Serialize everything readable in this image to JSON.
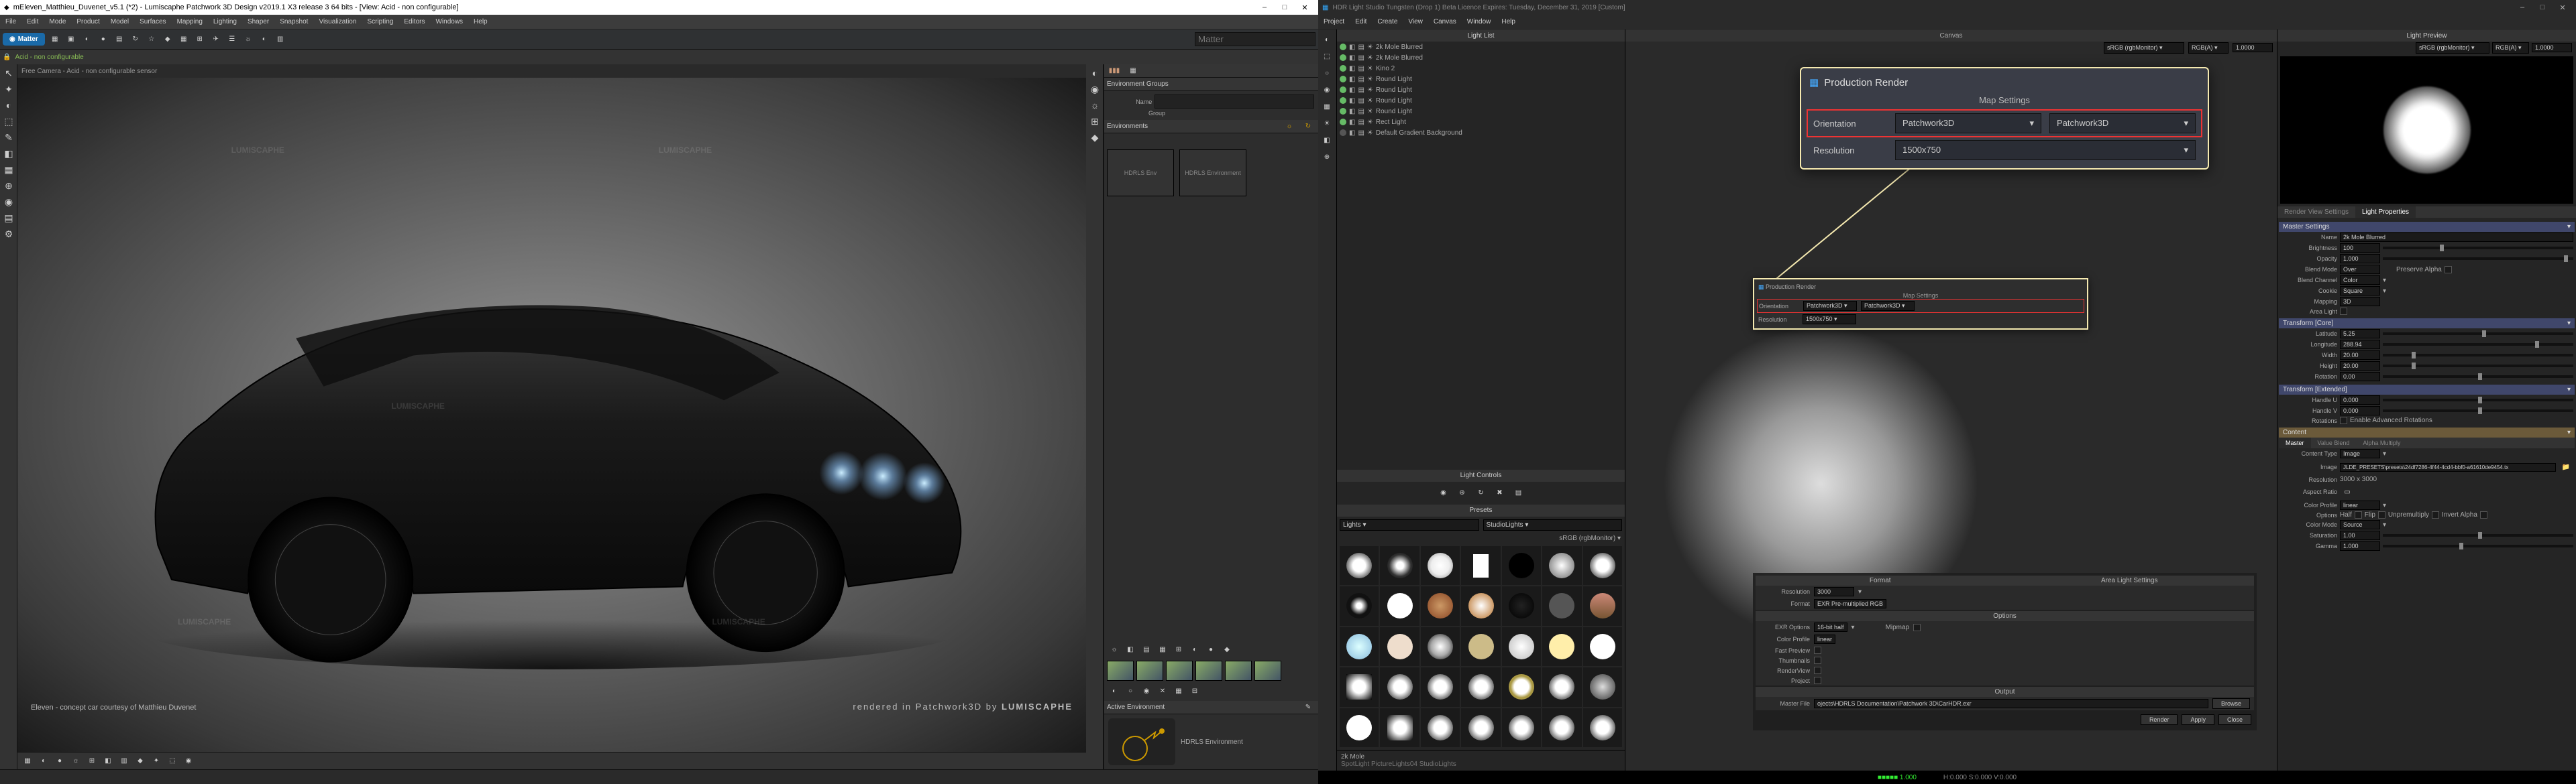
{
  "left_window": {
    "title": "mEleven_Matthieu_Duvenet_v5.1 (*2) - Lumiscaphe Patchwork 3D Design v2019.1 X3 release 3  64 bits - [View: Acid - non configurable]",
    "brand": "Matter",
    "menus": [
      "File",
      "Edit",
      "Mode",
      "Product",
      "Model",
      "Surfaces",
      "Mapping",
      "Lighting",
      "Shaper",
      "Snapshot",
      "Visualization",
      "Scripting",
      "Editors",
      "Windows",
      "Help"
    ],
    "tab_label": "Acid - non configurable",
    "vp_header": "Free Camera - Acid - non configurable sensor",
    "watermark": "LUMISCAPHE",
    "vp_bl": "Eleven - concept car courtesy of Matthieu Duvenet",
    "vp_br_prefix": "rendered in Patchwork3D by",
    "vp_br_brand": "LUMISCAPHE",
    "panels": {
      "env_groups": "Environment Groups",
      "name_lbl": "Name",
      "group_lbl": "Group",
      "envs_hdr": "Environments",
      "hdrls_env": "HDRLS Env",
      "hdrls_environment": "HDRLS Environment",
      "active_env": "Active Environment"
    }
  },
  "right_window": {
    "title": "HDR Light Studio Tungsten (Drop 1) Beta Licence Expires: Tuesday, December 31, 2019  [Custom]",
    "menus": [
      "Project",
      "Edit",
      "Create",
      "View",
      "Canvas",
      "Window",
      "Help"
    ],
    "light_list_hdr": "Light List",
    "lights": [
      {
        "name": "2k Mole Blurred",
        "on": true
      },
      {
        "name": "2k Mole Blurred",
        "on": true
      },
      {
        "name": "Kino 2",
        "on": true
      },
      {
        "name": "Round Light",
        "on": true
      },
      {
        "name": "Round Light",
        "on": true
      },
      {
        "name": "Round Light",
        "on": true
      },
      {
        "name": "Round Light",
        "on": true
      },
      {
        "name": "Rect Light",
        "on": true
      },
      {
        "name": "Default Gradient Background",
        "on": false
      }
    ],
    "light_controls_hdr": "Light Controls",
    "presets_hdr": "Presets",
    "presets_bar": {
      "left": "Lights",
      "right": "StudioLights",
      "srgb": "sRGB (rgbMonitor)"
    },
    "preset_footer": "2k Mole",
    "preset_path": "SpotLight PictureLights04 StudioLights",
    "canvas": {
      "hdr": "Canvas",
      "mode": "sRGB (rgbMonitor)",
      "space": "RGB(A)",
      "val": "1.0000"
    },
    "callout_big": {
      "title": "Production Render",
      "section": "Map Settings",
      "orientation_lbl": "Orientation",
      "orientation1": "Patchwork3D",
      "orientation2": "Patchwork3D",
      "resolution_lbl": "Resolution",
      "resolution": "1500x750"
    },
    "callout_small": {
      "title": "Production Render",
      "map_settings": "Map Settings",
      "orientation_lbl": "Orientation",
      "o1": "Patchwork3D",
      "o2": "Patchwork3D",
      "res_lbl": "Resolution",
      "res": "1500x750"
    },
    "settings_panel": {
      "format_sec": "Format",
      "res_lbl": "Resolution",
      "res_val": "3000",
      "format_lbl": "Format",
      "format_val": "EXR Pre-multiplied RGB",
      "als_sec": "Area Light Settings",
      "options_sec": "Options",
      "exr_lbl": "EXR Options",
      "exr_val": "16-bit half",
      "mipmap_lbl": "Mipmap",
      "cp_lbl": "Color Profile",
      "cp_val": "linear",
      "fast_lbl": "Fast Preview",
      "thumb_lbl": "Thumbnails",
      "rv_lbl": "RenderView",
      "proj_lbl": "Project",
      "output_sec": "Output",
      "mf_lbl": "Master File",
      "mf_val": "ojects\\HDRLS Documentation\\Patchwork 3D\\CarHDR.exr",
      "browse": "Browse",
      "render": "Render",
      "apply": "Apply",
      "close": "Close"
    },
    "light_preview_hdr": "Light Preview",
    "preview_bar": {
      "mode": "sRGB (rgbMonitor)",
      "space": "RGB(A)",
      "val": "1.0000"
    },
    "rvs_tab": "Render View Settings",
    "lp_tab": "Light Properties",
    "props": {
      "master_settings": "Master Settings",
      "name_lbl": "Name",
      "name_val": "2k Mole Blurred",
      "brightness_lbl": "Brightness",
      "brightness_val": "100",
      "opacity_lbl": "Opacity",
      "opacity_val": "1.000",
      "blend_lbl": "Blend Mode",
      "blend_val": "Over",
      "preserve_alpha": "Preserve Alpha",
      "blendch_lbl": "Blend Channel",
      "blendch_val": "Color",
      "cookie_lbl": "Cookie",
      "cookie_val": "Square",
      "mapping_lbl": "Mapping",
      "mapping_val": "3D",
      "area_light_lbl": "Area Light",
      "transform_core": "Transform [Core]",
      "lat_lbl": "Latitude",
      "lat_val": "5.25",
      "lon_lbl": "Longitude",
      "lon_val": "288.94",
      "width_lbl": "Width",
      "width_val": "20.00",
      "height_lbl": "Height",
      "height_val": "20.00",
      "rot_lbl": "Rotation",
      "rot_val": "0.00",
      "transform_ext": "Transform [Extended]",
      "h_u_lbl": "Handle U",
      "h_u_val": "0.000",
      "h_v_lbl": "Handle V",
      "h_v_val": "0.000",
      "rotations_lbl": "Rotations",
      "adv_rot": "Enable Advanced Rotations",
      "content_hdr": "Content",
      "tabs": {
        "master": "Master",
        "vb": "Value Blend",
        "am": "Alpha Multiply"
      },
      "ct_lbl": "Content Type",
      "ct_val": "Image",
      "img_lbl": "Image",
      "img_val": "JLDE_PRESETS\\presets\\24df7286-4f44-4cd4-bbf0-a61610de9454.tx",
      "cres_lbl": "Resolution",
      "cres_val": "3000 x 3000",
      "ar_lbl": "Aspect Ratio",
      "ccp_lbl": "Color Profile",
      "ccp_val": "linear",
      "copt_lbl": "Options",
      "half": "Half",
      "flip": "Flip",
      "unpre": "Unpremultiply",
      "invA": "Invert Alpha",
      "cm_lbl": "Color Mode",
      "cm_val": "Source",
      "sat_lbl": "Saturation",
      "sat_val": "1.00",
      "gamma_lbl": "Gamma",
      "gamma_val": "1.000"
    },
    "footer": {
      "gpu": "1.000",
      "coords": "H:0.000 S:0.000 V:0.000"
    }
  }
}
